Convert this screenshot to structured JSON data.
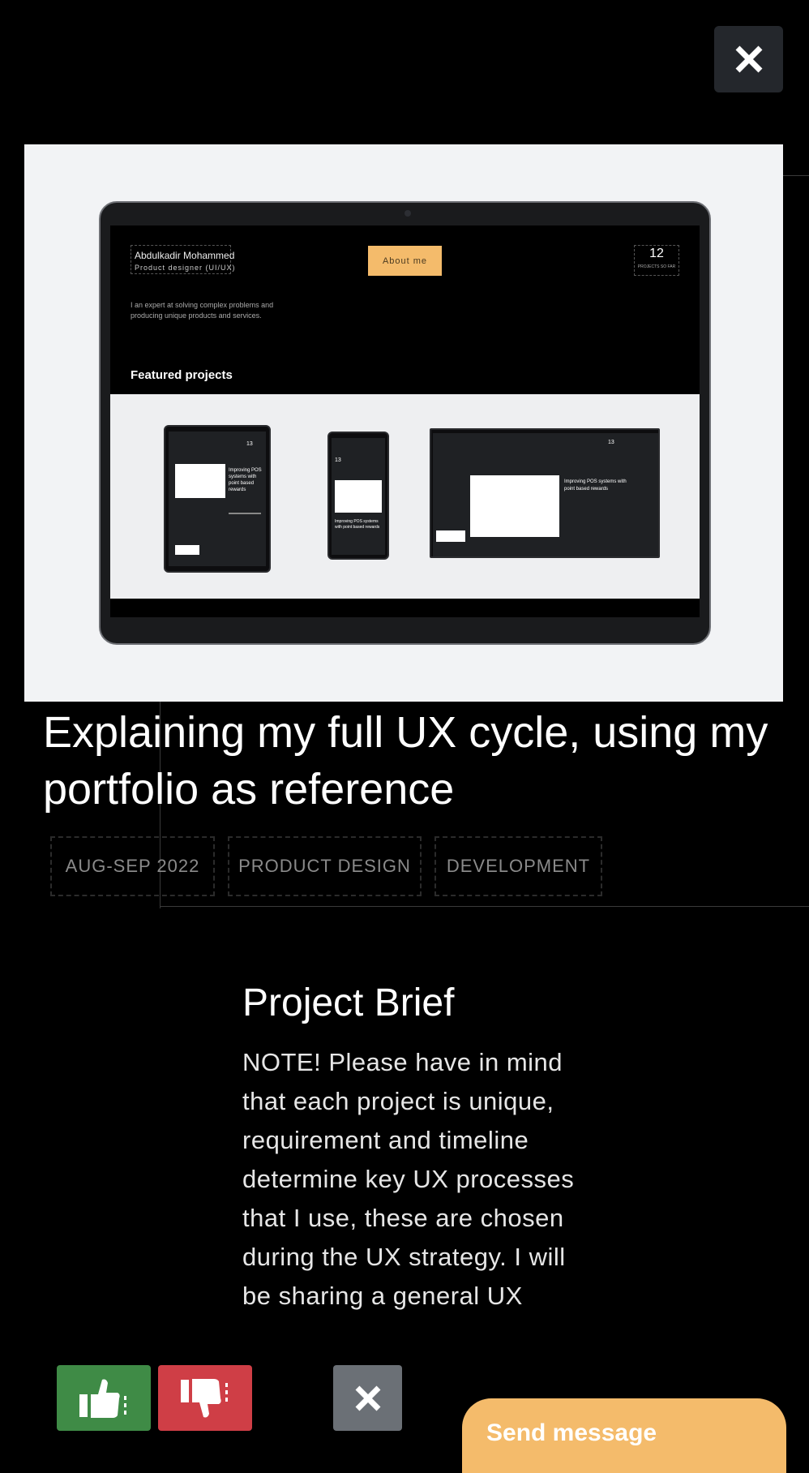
{
  "close_label": "Close",
  "hero": {
    "mini_site": {
      "name": "Abdulkadir Mohammed",
      "role": "Product designer  (UI/UX)",
      "about_button": "About me",
      "projects_count": "12",
      "projects_count_label": "PROJECTS SO FAR",
      "tagline": "I an expert at solving complex problems and producing unique products and services.",
      "featured_heading": "Featured projects",
      "device_counts": [
        "13",
        "13",
        "13"
      ],
      "device_headlines": [
        "Improving POS systems with point based rewards",
        "Improving POS systems with point based rewards",
        "Improving POS systems with point based rewards"
      ]
    }
  },
  "project": {
    "title": "Explaining my full UX cycle, using my portfolio as reference",
    "tags": [
      "AUG-SEP 2022",
      "PRODUCT DESIGN",
      "DEVELOPMENT"
    ],
    "brief_heading": "Project Brief",
    "brief_text": "NOTE! Please have in mind that each project is unique, requirement and timeline determine key UX processes that I use, these are chosen during the UX strategy. I will be sharing a general UX"
  },
  "actions": {
    "send_message": "Send message"
  },
  "colors": {
    "like": "#3f8b46",
    "dislike": "#cf3e46",
    "accent": "#f4bb6b",
    "neutral": "#6b7076"
  },
  "icons": [
    "close-icon",
    "thumbs-up-icon",
    "thumbs-down-icon"
  ]
}
